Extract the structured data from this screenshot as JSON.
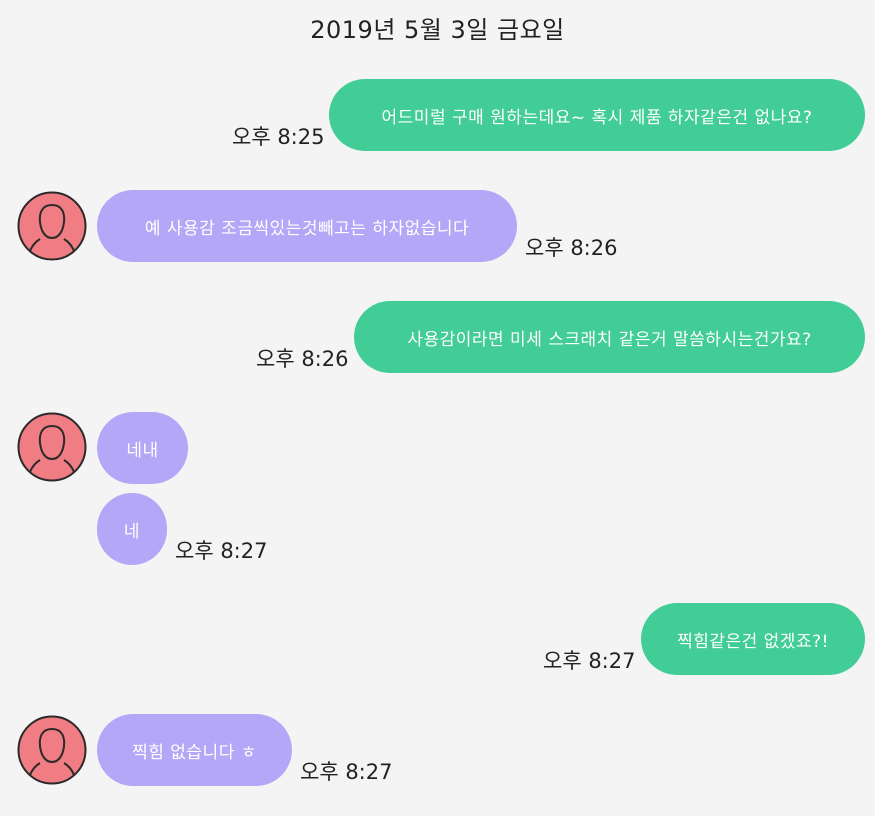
{
  "date_header": "2019년 5월 3일 금요일",
  "colors": {
    "me_bubble": "#41cd95",
    "them_bubble": "#b5a7f7",
    "avatar_bg": "#f07d84",
    "avatar_outline": "#2a2a2a",
    "background": "#f4f4f4"
  },
  "messages": [
    {
      "sender": "me",
      "text": "어드미럴 구매 원하는데요~ 혹시 제품 하자같은건 없나요?",
      "time": "오후 8:25"
    },
    {
      "sender": "them",
      "text": "예 사용감 조금씩있는것빼고는 하자없습니다",
      "time": "오후 8:26",
      "avatar": "default-profile-icon"
    },
    {
      "sender": "me",
      "text": "사용감이라면 미세 스크래치 같은거 말씀하시는건가요?",
      "time": "오후 8:26"
    },
    {
      "sender": "them",
      "text": "네내",
      "avatar": "default-profile-icon"
    },
    {
      "sender": "them",
      "text": "네",
      "time": "오후 8:27"
    },
    {
      "sender": "me",
      "text": "찍힘같은건 없겠죠?!",
      "time": "오후 8:27"
    },
    {
      "sender": "them",
      "text": "찍힘 없습니다 ㅎ",
      "time": "오후 8:27",
      "avatar": "default-profile-icon"
    }
  ]
}
